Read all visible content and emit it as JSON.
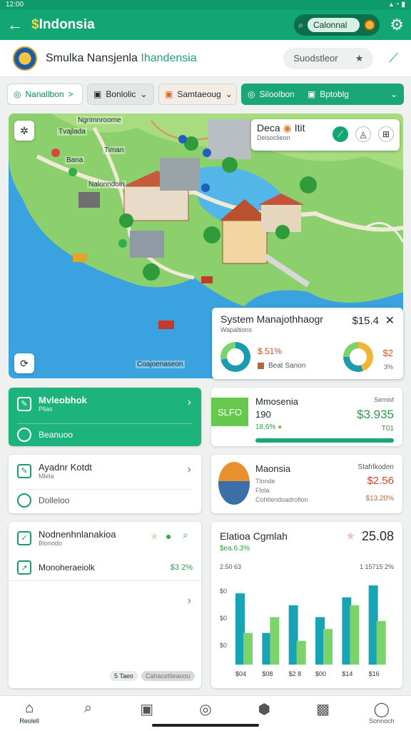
{
  "status": {
    "time": "12:00"
  },
  "appbar": {
    "title_icon": "$",
    "title": "Indonsia",
    "pill_label": "Calonnal",
    "icons": [
      "back-arrow-icon",
      "search-icon",
      "coin-icon",
      "gear-icon"
    ]
  },
  "header": {
    "name_part1": "Smulka Nansjenla",
    "name_part2": "Ihandensia",
    "search_placeholder": "Suodstleor"
  },
  "filters": [
    {
      "label": "Nanallbon",
      "chevron": ">"
    },
    {
      "label": "Bonlolic",
      "chevron": "⌄"
    },
    {
      "label": "Samtaeoug",
      "chevron": "⌄"
    },
    {
      "label": "Siloolbon",
      "label2": "Bptoblg",
      "chevron": "⌄"
    }
  ],
  "map": {
    "labels": [
      "Ngrimnroome",
      "Timan",
      "Tvajlada",
      "Bana",
      "Nalonndoln"
    ],
    "footer": "Coajoenaseon",
    "info_title": "Deca",
    "info_title_suffix": "Itit",
    "info_sub": "Deisoclieon"
  },
  "system_card": {
    "title": "System Manajothhaogr",
    "price": "$15.4",
    "sub": "Wapaltions",
    "pct": "$.51%",
    "tag": "Beat Sanon",
    "right_val": "$2",
    "right_sub": "3%"
  },
  "cards": {
    "c1": {
      "title": "Mvleobhok",
      "sub": "Pllas",
      "item": "Beanuoo"
    },
    "c2": {
      "title": "Mmosenia",
      "val1": "190",
      "tag": "SLFO",
      "pct": "18.6%",
      "right_label": "Sernisf",
      "right_val": "$3.935",
      "right_sub": "T01"
    },
    "c3": {
      "title": "Ayadnr Kotdt",
      "sub": "Mlela",
      "item": "Dolleloo"
    },
    "c4": {
      "title": "Maonsia",
      "sub1": "Tlonde",
      "sub2": "Flola",
      "sub3": "Cohtlendoadroflon",
      "right_label": "Stafrlkoden",
      "right_val": "$2.56",
      "right_sub": "$13.20%"
    },
    "c5": {
      "title": "Nodnenhnlanakioa",
      "sub": "Blonodo",
      "item": "Monoheraeiolk",
      "item_val": "$3 2%",
      "footer_left": "5 Taeo",
      "footer_right": "Cahacetileaoou"
    },
    "c6": {
      "title": "Elatioa Cgmlah",
      "sub": "$ea.6.3%",
      "big": "25.08",
      "left_label": "2.50 63",
      "right_label": "1 15715 2%"
    }
  },
  "chart_data": {
    "type": "bar",
    "categories": [
      "$04",
      "$08",
      "$2 8",
      "$00",
      "$14",
      "$16"
    ],
    "y_tick_labels": [
      "$0",
      "$0",
      "$0"
    ],
    "series": [
      {
        "values": [
          18,
          8,
          15,
          12,
          17,
          20
        ],
        "color": "#18a4b7"
      },
      {
        "values": [
          8,
          12,
          6,
          9,
          15,
          11
        ],
        "color": "#7bd36c"
      }
    ],
    "ylim": [
      0,
      22
    ]
  },
  "nav": [
    {
      "label": "Reolell",
      "icon": "home-icon"
    },
    {
      "label": "",
      "icon": "search-icon"
    },
    {
      "label": "",
      "icon": "bag-icon"
    },
    {
      "label": "",
      "icon": "compass-icon"
    },
    {
      "label": "",
      "icon": "hexagon-icon"
    },
    {
      "label": "",
      "icon": "briefcase-icon"
    },
    {
      "label": "Sonnoch",
      "icon": "profile-icon"
    }
  ]
}
